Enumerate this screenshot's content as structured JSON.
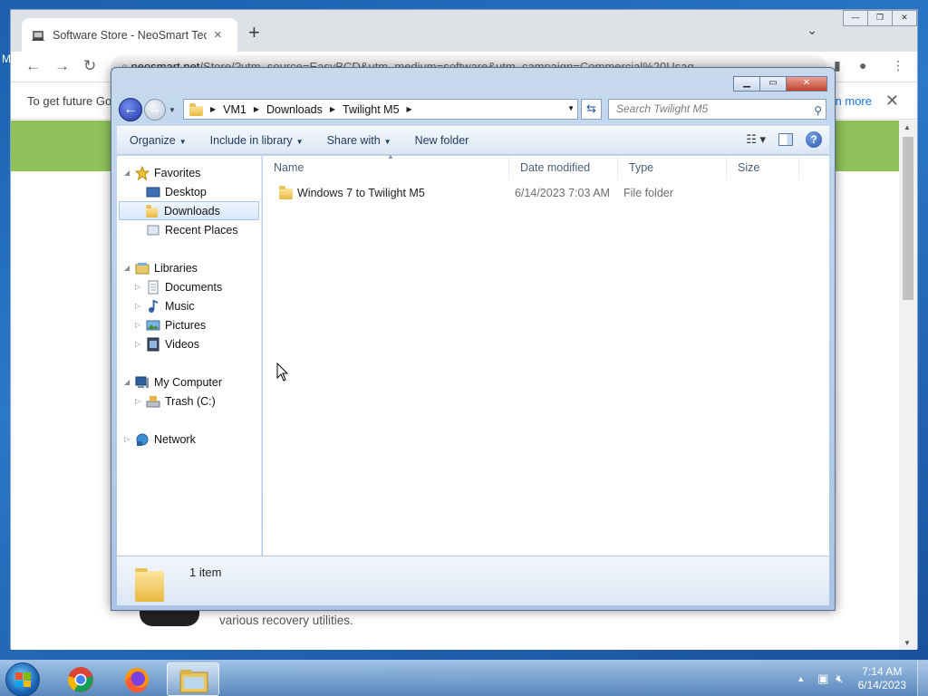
{
  "browser": {
    "tab_title": "Software Store - NeoSmart Techn",
    "tab_close": "×",
    "new_tab": "+",
    "tab_menu": "⌄",
    "url_domain": "neosmart.net",
    "url_path": "/Store/?utm_source=EasyBCD&utm_medium=software&utm_campaign=Commercial%20Usag",
    "infobar_message": "To get future Go",
    "infobar_link": "n more",
    "infobar_close": "✕",
    "page_text": "various recovery utilities.",
    "side_letter": "M",
    "win_controls": [
      "—",
      "❐",
      "✕"
    ]
  },
  "explorer": {
    "breadcrumbs": [
      "VM1",
      "Downloads",
      "Twilight M5"
    ],
    "search_placeholder": "Search Twilight M5",
    "commands": [
      {
        "label": "Organize",
        "has_menu": true
      },
      {
        "label": "Include in library",
        "has_menu": true
      },
      {
        "label": "Share with",
        "has_menu": true
      },
      {
        "label": "New folder",
        "has_menu": false
      }
    ],
    "nav": {
      "favorites": {
        "label": "Favorites",
        "items": [
          "Desktop",
          "Downloads",
          "Recent Places"
        ]
      },
      "libraries": {
        "label": "Libraries",
        "items": [
          "Documents",
          "Music",
          "Pictures",
          "Videos"
        ]
      },
      "computer": {
        "label": "My Computer",
        "items": [
          "Trash (C:)"
        ]
      },
      "network": {
        "label": "Network"
      }
    },
    "selected_nav": "Downloads",
    "columns": [
      "Name",
      "Date modified",
      "Type",
      "Size"
    ],
    "files": [
      {
        "name": "Windows 7 to Twilight M5",
        "date": "6/14/2023 7:03 AM",
        "type": "File folder",
        "size": ""
      }
    ],
    "status_count": "1 item"
  },
  "taskbar": {
    "time": "7:14 AM",
    "date": "6/14/2023",
    "apps": [
      "chrome",
      "firefox",
      "explorer"
    ]
  },
  "colors": {
    "page_banner": "#8fc25a",
    "link": "#1a73e8",
    "close_button": "#c3412c"
  }
}
